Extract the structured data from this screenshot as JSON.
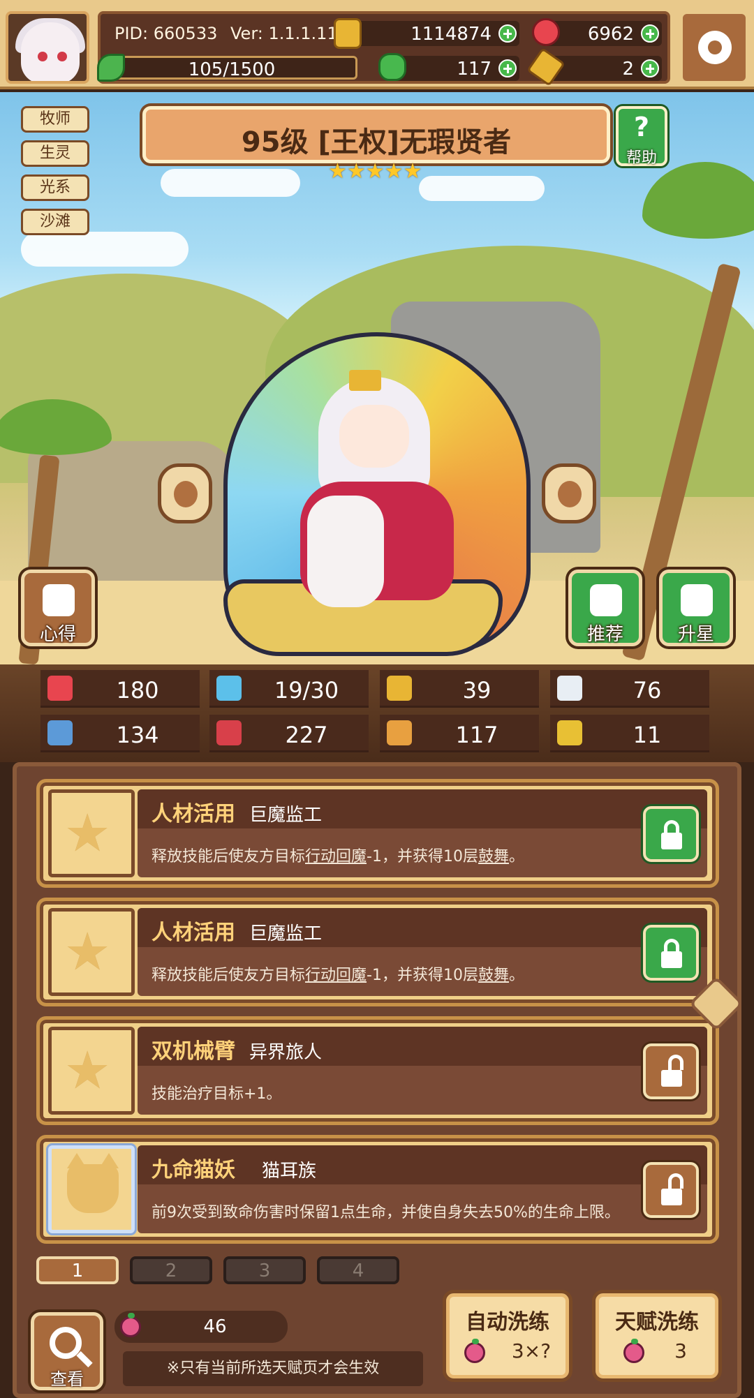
{
  "topbar": {
    "pid": "PID: 660533",
    "version": "Ver: 1.1.1.11",
    "gold": "1114874",
    "ruby": "6962",
    "stamina": "105/1500",
    "clover": "117",
    "keys": "2"
  },
  "scene": {
    "tags": [
      "牧师",
      "生灵",
      "光系",
      "沙滩"
    ],
    "title": "95级 [王权]无瑕贤者",
    "star_count": 5,
    "stars": "★★★★★",
    "help_label": "帮助",
    "left_button": "心得",
    "right_buttons": [
      "推荐",
      "升星"
    ]
  },
  "stats": [
    {
      "icon": "heart-icon",
      "value": "180",
      "color": "#e8454f"
    },
    {
      "icon": "water-drop-icon",
      "value": "19/30",
      "color": "#5cc0ea"
    },
    {
      "icon": "shield-icon",
      "value": "39",
      "color": "#e8b534"
    },
    {
      "icon": "wing-icon",
      "value": "76",
      "color": "#e8eef4"
    },
    {
      "icon": "fist-icon",
      "value": "134",
      "color": "#5c9ad8"
    },
    {
      "icon": "book-icon",
      "value": "227",
      "color": "#d8404a"
    },
    {
      "icon": "boot-icon",
      "value": "117",
      "color": "#e8a040"
    },
    {
      "icon": "horseshoe-icon",
      "value": "11",
      "color": "#e8c034"
    }
  ],
  "talents": [
    {
      "name": "人材活用",
      "sub": "巨魔监工",
      "desc_pre": "释放技能后使友方目标",
      "desc_u1": "行动回魔",
      "desc_mid": "-1，并获得10层",
      "desc_u2": "鼓舞",
      "desc_post": "。",
      "locked": true,
      "icon": "star-icon"
    },
    {
      "name": "人材活用",
      "sub": "巨魔监工",
      "desc_pre": "释放技能后使友方目标",
      "desc_u1": "行动回魔",
      "desc_mid": "-1，并获得10层",
      "desc_u2": "鼓舞",
      "desc_post": "。",
      "locked": true,
      "icon": "star-icon"
    },
    {
      "name": "双机械臂",
      "sub": "异界旅人",
      "desc_pre": "技能治疗目标+1。",
      "desc_u1": "",
      "desc_mid": "",
      "desc_u2": "",
      "desc_post": "",
      "locked": false,
      "icon": "star-icon"
    },
    {
      "name": "九命猫妖",
      "sub": "猫耳族",
      "desc_pre": "前9次受到致命伤害时保留1点生命，并使自身失去50%的生命上限。",
      "desc_u1": "",
      "desc_mid": "",
      "desc_u2": "",
      "desc_post": "",
      "locked": false,
      "icon": "cat-icon"
    }
  ],
  "pages": {
    "tabs": [
      "1",
      "2",
      "3",
      "4"
    ],
    "active": "1"
  },
  "bottom": {
    "view_label": "查看",
    "fruit_count": "46",
    "note": "※只有当前所选天赋页才会生效",
    "auto_reroll_label": "自动洗练",
    "auto_reroll_cost": "3×?",
    "talent_reroll_label": "天赋洗练",
    "talent_reroll_cost": "3"
  }
}
